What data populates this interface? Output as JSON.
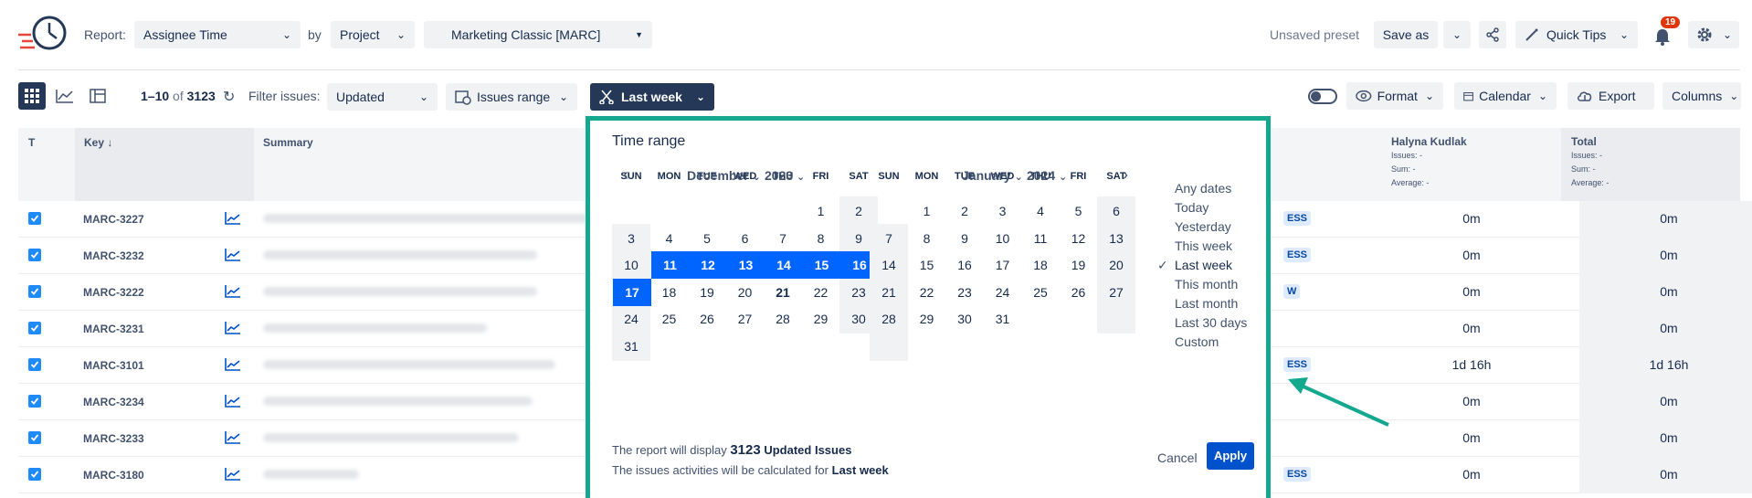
{
  "header": {
    "report_label": "Report:",
    "report_value": "Assignee Time",
    "by_label": "by",
    "by_value": "Project",
    "project_value": "Marketing Classic [MARC]",
    "unsaved": "Unsaved preset",
    "save_as": "Save as",
    "quick_tips": "Quick Tips",
    "notifications": "19"
  },
  "toolbar": {
    "range_start": "1–10",
    "range_of": "of",
    "range_total": "3123",
    "filter_label": "Filter issues:",
    "filter_value": "Updated",
    "issues_range": "Issues range",
    "last_week": "Last week",
    "format": "Format",
    "calendar": "Calendar",
    "export": "Export",
    "columns": "Columns"
  },
  "table": {
    "col_t": "T",
    "col_key": "Key",
    "col_summary": "Summary",
    "assignee": "Halyna Kudlak",
    "total": "Total",
    "stat_issues": "Issues: -",
    "stat_sum": "Sum: -",
    "stat_avg": "Average: -",
    "rows": [
      {
        "key": "MARC-3227",
        "status": "ESS",
        "m1": "0m",
        "m2": "0m"
      },
      {
        "key": "MARC-3232",
        "status": "ESS",
        "m1": "0m",
        "m2": "0m"
      },
      {
        "key": "MARC-3222",
        "status": "W",
        "m1": "0m",
        "m2": "0m"
      },
      {
        "key": "MARC-3231",
        "status": "",
        "m1": "0m",
        "m2": "0m"
      },
      {
        "key": "MARC-3101",
        "status": "ESS",
        "m1": "1d 16h",
        "m2": "1d 16h"
      },
      {
        "key": "MARC-3234",
        "status": "",
        "m1": "0m",
        "m2": "0m"
      },
      {
        "key": "MARC-3233",
        "status": "",
        "m1": "0m",
        "m2": "0m"
      },
      {
        "key": "MARC-3180",
        "status": "ESS",
        "m1": "0m",
        "m2": "0m"
      }
    ]
  },
  "popup": {
    "title": "Time range",
    "left_month": "December",
    "left_year": "2023",
    "right_month": "January",
    "right_year": "2024",
    "weekdays": [
      "SUN",
      "MON",
      "TUE",
      "WED",
      "THU",
      "FRI",
      "SAT"
    ],
    "presets": [
      "Any dates",
      "Today",
      "Yesterday",
      "This week",
      "Last week",
      "This month",
      "Last month",
      "Last 30 days",
      "Custom"
    ],
    "info_prefix": "The report will display",
    "info_count": "3123",
    "info_suffix": "Updated Issues",
    "info2_prefix": "The issues activities will be calculated for",
    "info2_value": "Last week",
    "cancel": "Cancel",
    "apply": "Apply"
  },
  "colors": {
    "accent": "#0065ff",
    "frame": "#14a88e",
    "dark_button": "#253858",
    "badge": "#de350b"
  }
}
